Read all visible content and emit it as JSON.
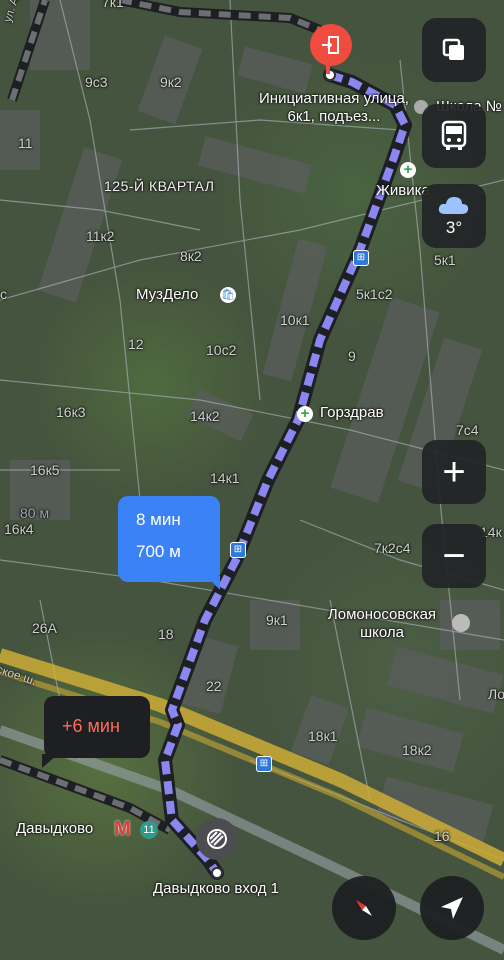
{
  "labels": {
    "district": "125-Й КВАРТАЛ",
    "street_artam": "ул. Артам",
    "street_shosse": "ское ш.",
    "houses": [
      "7к1",
      "9с3",
      "9к2",
      "11",
      "11к2",
      "8к2",
      "12",
      "10с2",
      "10к1",
      "5к1с2",
      "5к1",
      "9",
      "16к3",
      "14к2",
      "16к5",
      "14к1",
      "16к4",
      "7с4",
      "26А",
      "18",
      "7к2с4",
      "9к1",
      "22",
      "18к1",
      "18к2",
      "16",
      "14к",
      "Ло",
      "с"
    ],
    "dim_walk": "80 м"
  },
  "pois": {
    "destination": "Инициативная улица, 6к1, подъез...",
    "zhivika": "Живика",
    "muzdelo": "МузДело",
    "gorzdrav": "Горздрав",
    "lomonosov_school": "Ломоносовская школа",
    "school_top": "Школа №",
    "metro": "Давыдково",
    "metro_line": "11",
    "metro_entrance": "Давыдково вход 1"
  },
  "route": {
    "time": "8 мин",
    "distance": "700 м",
    "alt_time": "+6 мин"
  },
  "weather": {
    "temperature": "3°",
    "icon": "cloud-icon"
  },
  "controls": {
    "layers_icon": "layers-icon",
    "transport_icon": "bus-icon",
    "zoom_in": "+",
    "zoom_out": "−",
    "compass_icon": "compass-icon",
    "locate_icon": "navigation-arrow-icon"
  },
  "colors": {
    "route": "#8a87f0",
    "route_border": "#2a2a2a",
    "accent_blue": "#3b82f6",
    "alt_red": "#ff6b5b",
    "destination": "#ef4b3f"
  }
}
